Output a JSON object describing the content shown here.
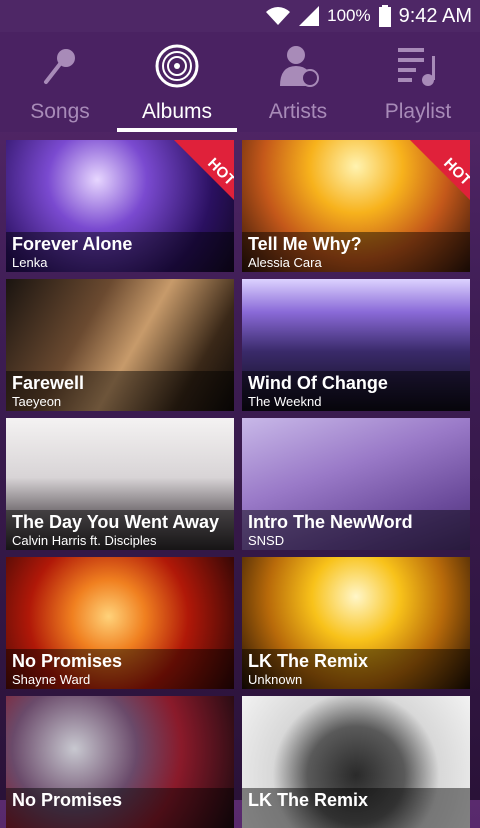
{
  "status": {
    "battery": "100%",
    "time": "9:42 AM"
  },
  "tabs": [
    {
      "label": "Songs",
      "icon": "microphone-icon"
    },
    {
      "label": "Albums",
      "icon": "vinyl-disc-icon"
    },
    {
      "label": "Artists",
      "icon": "artist-icon"
    },
    {
      "label": "Playlist",
      "icon": "playlist-icon"
    }
  ],
  "albums": [
    {
      "title": "Forever Alone",
      "artist": "Lenka",
      "hot": "HOT"
    },
    {
      "title": "Tell Me Why?",
      "artist": "Alessia Cara",
      "hot": "HOT"
    },
    {
      "title": "Farewell",
      "artist": "Taeyeon"
    },
    {
      "title": "Wind Of Change",
      "artist": "The Weeknd"
    },
    {
      "title": "The Day You Went Away",
      "artist": "Calvin Harris ft. Disciples"
    },
    {
      "title": "Intro The NewWord",
      "artist": "SNSD"
    },
    {
      "title": "No Promises",
      "artist": "Shayne Ward"
    },
    {
      "title": "LK The Remix",
      "artist": "Unknown"
    },
    {
      "title": "No Promises",
      "artist": ""
    },
    {
      "title": "LK The Remix",
      "artist": ""
    }
  ],
  "colors": {
    "accent": "#e0213a",
    "header": "#4a2262"
  }
}
